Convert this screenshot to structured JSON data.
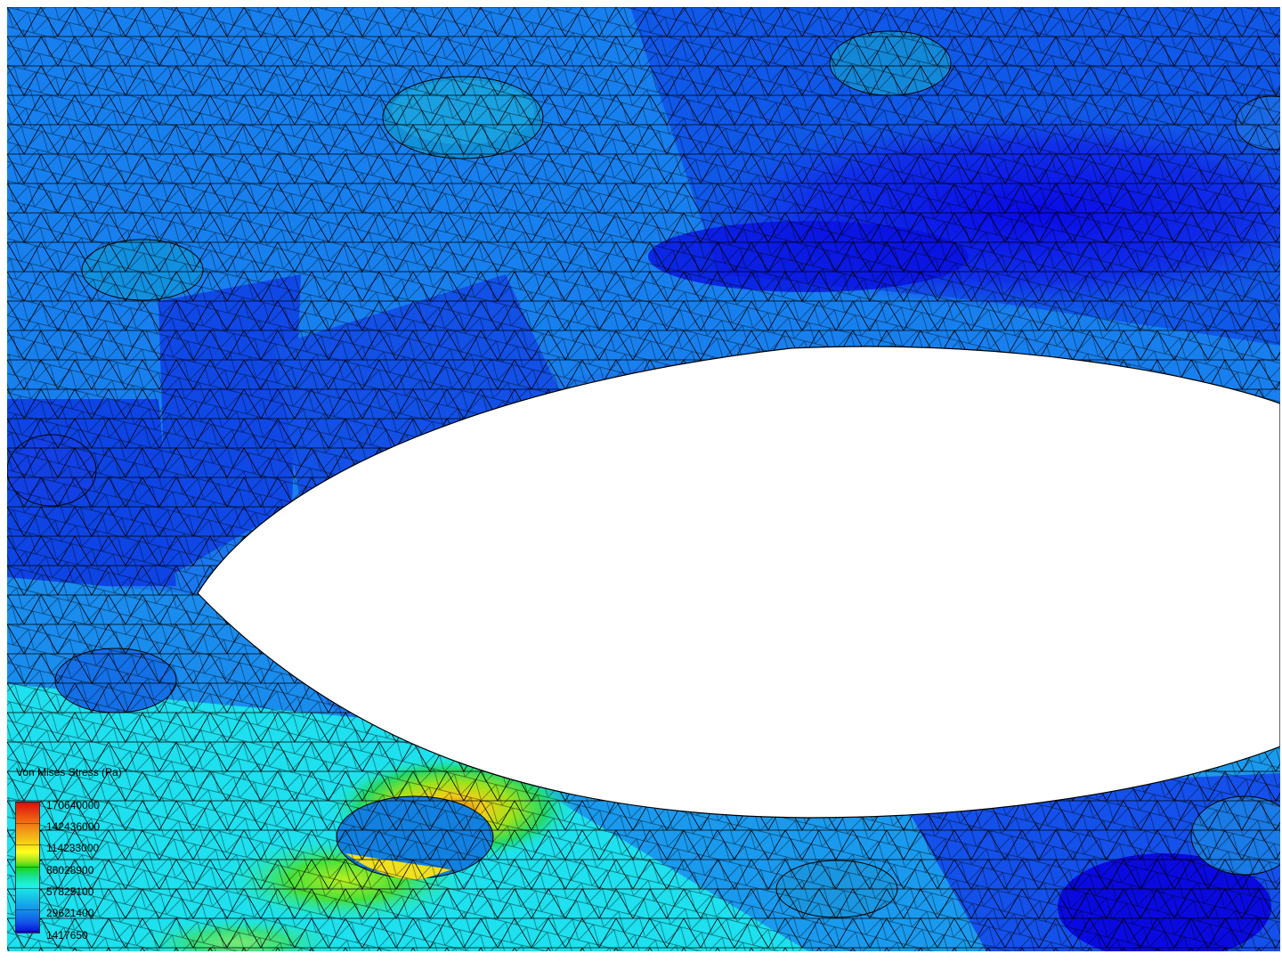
{
  "legend": {
    "title": "Von Mises Stress (Pa)",
    "labels": [
      "170640000",
      "142436000",
      "114233000",
      "86028900",
      "57825100",
      "29621400",
      "1417650"
    ]
  },
  "colors": {
    "background": "#ffffff",
    "mesh_lines": "#000000",
    "stress_low": "#0a0ad8",
    "stress_mid_low": "#1494ec",
    "stress_mid": "#1ef2e6",
    "stress_mid_high": "#18d818",
    "stress_high": "#ffff1e",
    "stress_max": "#d81010"
  }
}
